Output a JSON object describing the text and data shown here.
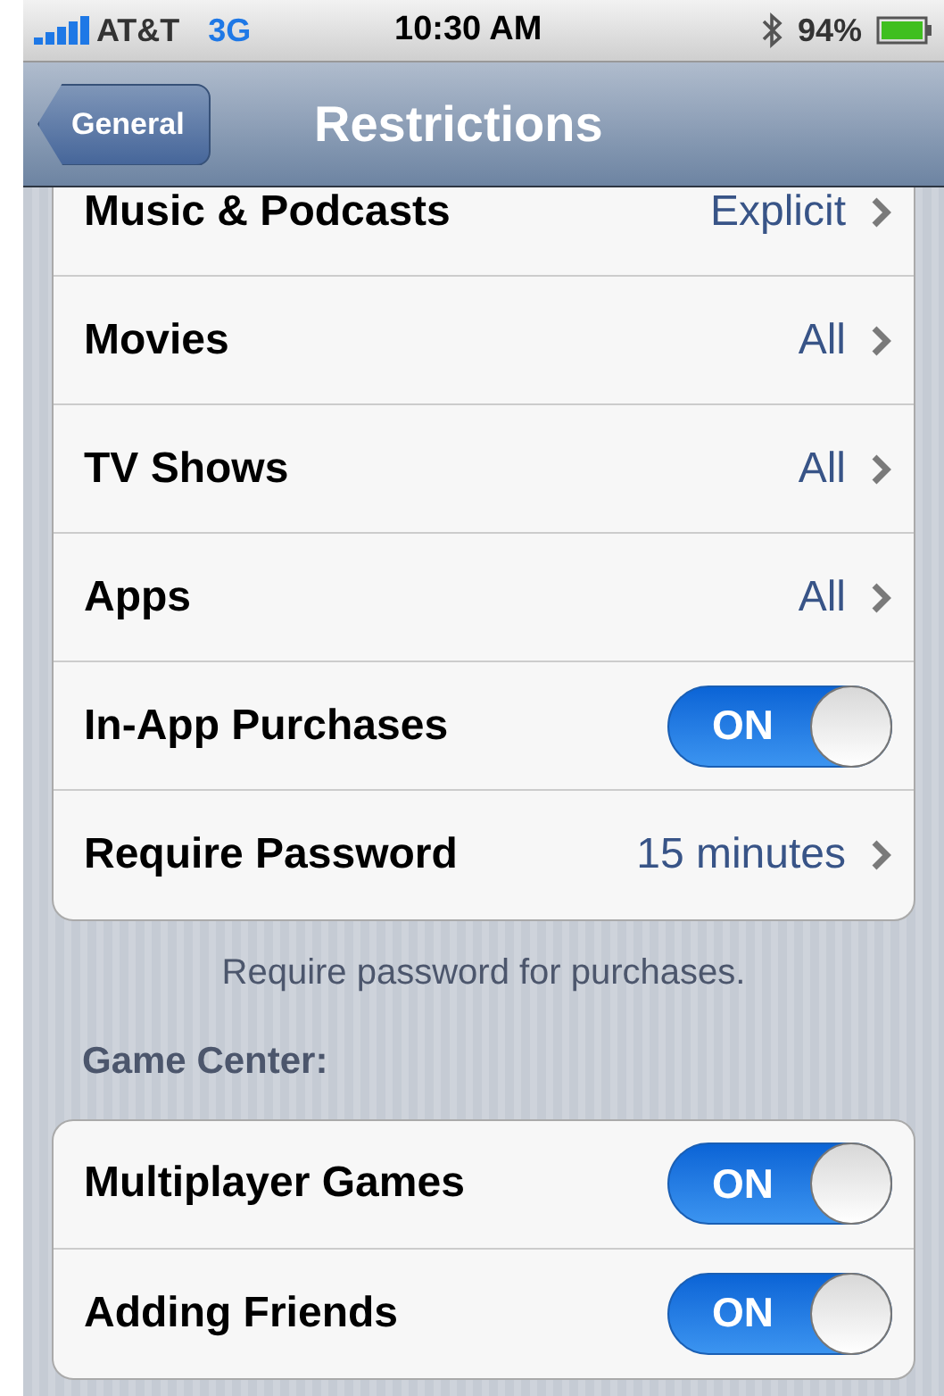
{
  "status_bar": {
    "carrier": "AT&T",
    "network": "3G",
    "time": "10:30 AM",
    "battery": "94%"
  },
  "nav_bar": {
    "back": "General",
    "title": "Restrictions"
  },
  "sections": [
    {
      "rows": [
        {
          "kind": "disclosure",
          "label": "Music & Podcasts",
          "value": "Explicit"
        },
        {
          "kind": "disclosure",
          "label": "Movies",
          "value": "All"
        },
        {
          "kind": "disclosure",
          "label": "TV Shows",
          "value": "All"
        },
        {
          "kind": "disclosure",
          "label": "Apps",
          "value": "All"
        },
        {
          "kind": "toggle",
          "label": "In-App Purchases",
          "on": true,
          "on_label": "ON"
        },
        {
          "kind": "disclosure",
          "label": "Require Password",
          "value": "15 minutes"
        }
      ],
      "footer": "Require password for purchases."
    },
    {
      "header": "Game Center:",
      "rows": [
        {
          "kind": "toggle",
          "label": "Multiplayer Games",
          "on": true,
          "on_label": "ON"
        },
        {
          "kind": "toggle",
          "label": "Adding Friends",
          "on": true,
          "on_label": "ON"
        }
      ]
    }
  ]
}
